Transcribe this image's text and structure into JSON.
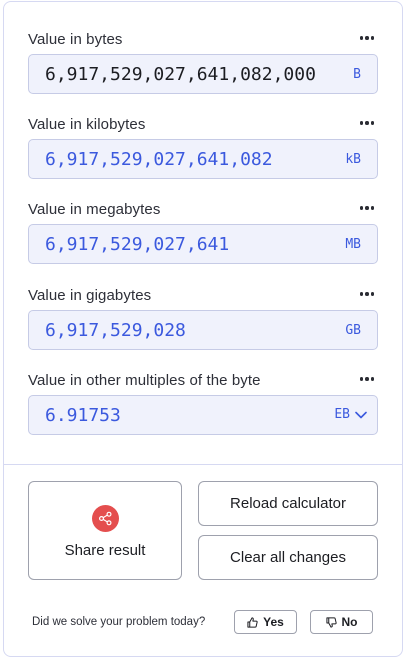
{
  "fields": [
    {
      "label": "Value in bytes",
      "value": "6,917,529,027,641,082,000",
      "unit": "B"
    },
    {
      "label": "Value in kilobytes",
      "value": "6,917,529,027,641,082",
      "unit": "kB"
    },
    {
      "label": "Value in megabytes",
      "value": "6,917,529,027,641",
      "unit": "MB"
    },
    {
      "label": "Value in gigabytes",
      "value": "6,917,529,028",
      "unit": "GB"
    },
    {
      "label": "Value in other multiples of the byte",
      "value": "6.91753",
      "unit": "EB"
    }
  ],
  "buttons": {
    "share": "Share result",
    "reload": "Reload calculator",
    "clear": "Clear all changes"
  },
  "feedback": {
    "question": "Did we solve your problem today?",
    "yes": "Yes",
    "no": "No"
  },
  "colors": {
    "accent": "#3b59de",
    "share_icon_bg": "#e44e4e",
    "field_bg": "#f0f2fc"
  },
  "icons": {
    "menu": "more-dots-icon",
    "share": "share-icon",
    "dropdown": "chevron-down-icon",
    "yes": "thumbs-up-icon",
    "no": "thumbs-down-icon"
  }
}
